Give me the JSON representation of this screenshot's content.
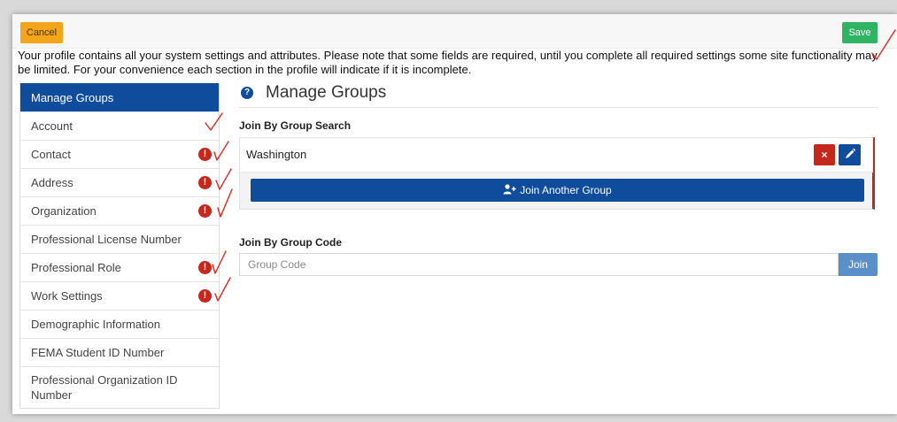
{
  "toolbar": {
    "cancel_label": "Cancel",
    "save_label": "Save"
  },
  "intro_text": "Your profile contains all your system settings and attributes. Please note that some fields are required, until you complete all required settings some site functionality may be limited. For your convenience each section in the profile will indicate if it is incomplete.",
  "sidebar": {
    "items": [
      {
        "label": "Manage Groups",
        "active": true,
        "warning": false
      },
      {
        "label": "Account",
        "warning": false
      },
      {
        "label": "Contact",
        "warning": true
      },
      {
        "label": "Address",
        "warning": true
      },
      {
        "label": "Organization",
        "warning": true
      },
      {
        "label": "Professional License Number",
        "warning": false
      },
      {
        "label": "Professional Role",
        "warning": true
      },
      {
        "label": "Work Settings",
        "warning": true
      },
      {
        "label": "Demographic Information",
        "warning": false
      },
      {
        "label": "FEMA Student ID Number",
        "warning": false
      },
      {
        "label": "Professional Organization ID Number",
        "warning": false
      }
    ],
    "warning_glyph": "!"
  },
  "main": {
    "help_glyph": "?",
    "title": "Manage Groups",
    "search_section_label": "Join By Group Search",
    "group_name": "Washington",
    "remove_glyph": "×",
    "join_another_label": "Join Another Group",
    "code_section_label": "Join By Group Code",
    "code_placeholder": "Group Code",
    "join_label": "Join"
  },
  "colors": {
    "primary": "#0f4c9c",
    "danger": "#c4271b",
    "save": "#2fb463",
    "cancel": "#f4a51c",
    "annotation": "#e0281e"
  },
  "icons": [
    "question-circle-icon",
    "exclamation-circle-icon",
    "times-icon",
    "pencil-icon",
    "user-plus-icon"
  ]
}
